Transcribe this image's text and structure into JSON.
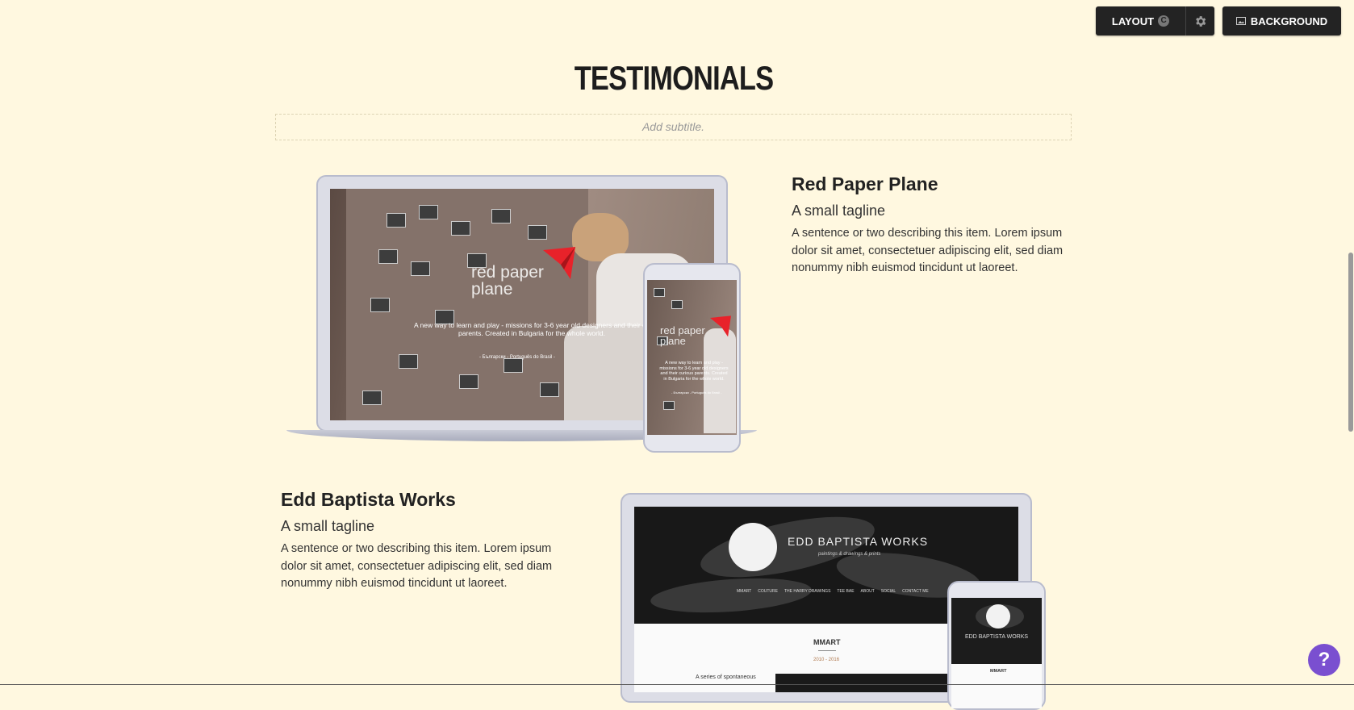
{
  "toolbar": {
    "layout_label": "LAYOUT",
    "layout_badge": "C",
    "background_label": "BACKGROUND"
  },
  "section": {
    "title": "TESTIMONIALS",
    "subtitle_placeholder": "Add subtitle."
  },
  "items": [
    {
      "title": "Red Paper Plane",
      "tagline": "A small tagline",
      "description": "A sentence or two describing this item. Lorem ipsum dolor sit amet, consectetuer adipiscing elit, sed diam nonummy nibh euismod tincidunt ut laoreet.",
      "screen": {
        "brand": "red paper plane",
        "brand_line1": "red paper",
        "brand_line2": "plane",
        "body": "A new way to learn and play - missions for 3-6 year old designers and their curious parents. Created in Bulgaria for the whole world.",
        "body_line1": "A new way to learn and play - missions for 3-6 year old designers and their cu",
        "body_line2": "parents. Created in Bulgaria for the whole world.",
        "languages": "- Български - Português do Brasil -",
        "phone_body": "A new way to learn and play - missions for 3-6 year old designers and their curious parents. Created in Bulgaria for the whole world.",
        "phone_languages": "- Български - Português do Brasil -"
      }
    },
    {
      "title": "Edd Baptista Works",
      "tagline": "A small tagline",
      "description": "A sentence or two describing this item. Lorem ipsum dolor sit amet, consectetuer adipiscing elit, sed diam nonummy nibh euismod tincidunt ut laoreet.",
      "screen": {
        "brand": "EDD BAPTISTA WORKS",
        "brand_sub": "paintings & drawings & prints",
        "nav": [
          "MMART",
          "COUTURE",
          "THE HARRY DRAWINGS",
          "TEE BAE",
          "ABOUT",
          "SOCIAL",
          "CONTACT ME"
        ],
        "section": "MMART",
        "years": "2010 - 2016",
        "snippet": "A series of spontaneous",
        "phone_section": "MMART"
      }
    }
  ],
  "help": {
    "label": "?"
  }
}
